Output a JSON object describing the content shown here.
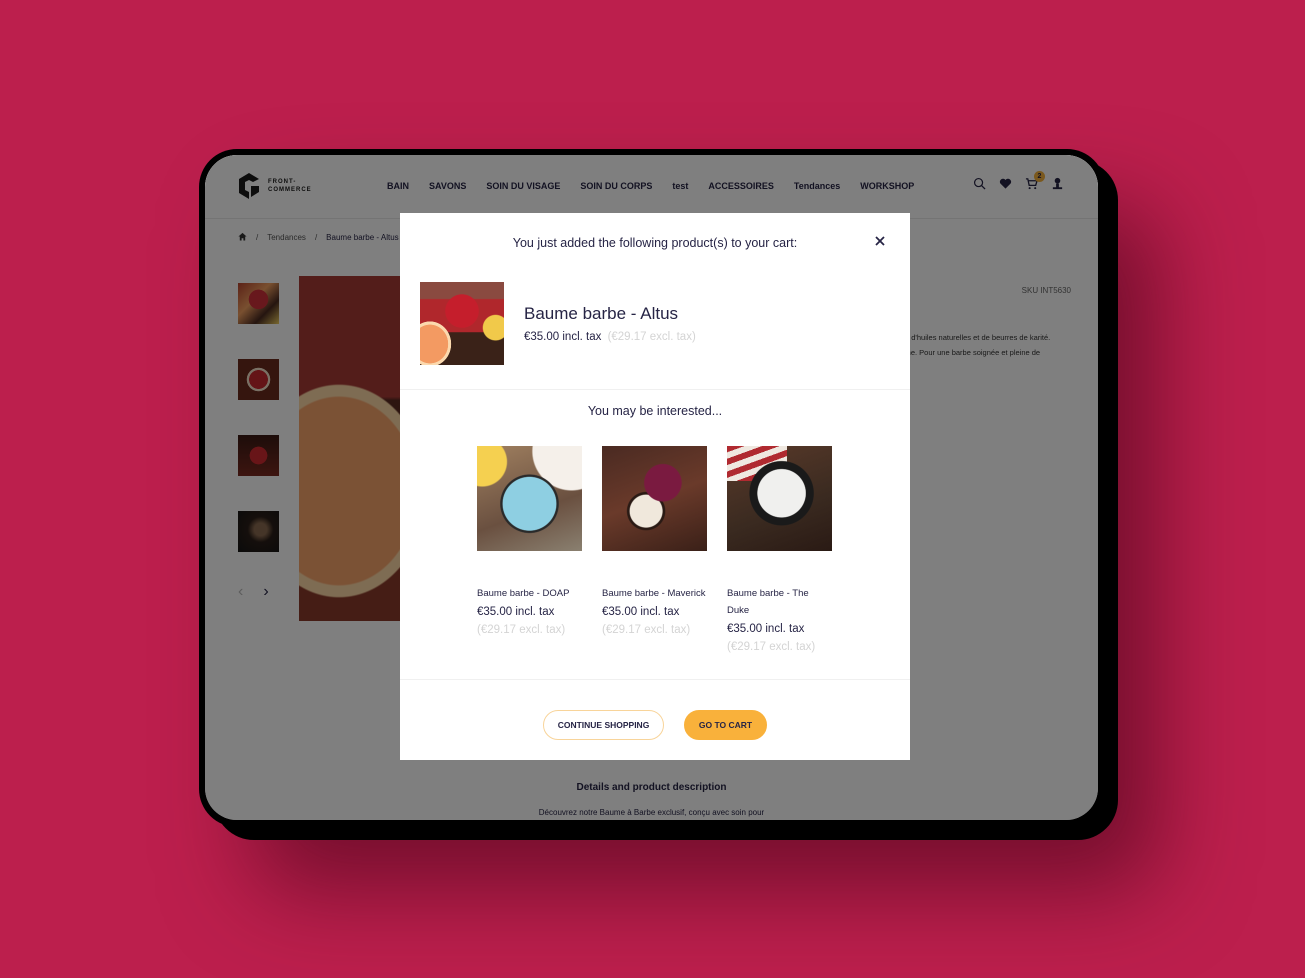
{
  "colors": {
    "background": "#bc1f4d",
    "accent": "#f9b13b",
    "text": "#262445",
    "muted": "#d4d4d4"
  },
  "header": {
    "logo": {
      "line1": "FRONT-",
      "line2": "COMMERCE",
      "icon": "front-commerce-logo"
    },
    "nav": [
      "BAIN",
      "SAVONS",
      "SOIN DU VISAGE",
      "SOIN DU CORPS",
      "test",
      "ACCESSOIRES",
      "Tendances",
      "WORKSHOP"
    ],
    "icons": {
      "search": "search-icon",
      "wishlist": "heart-icon",
      "cart": "cart-icon",
      "account": "user-icon"
    },
    "cart_count": "2"
  },
  "breadcrumb": {
    "home_icon": "home-icon",
    "separator": "/",
    "items": [
      "Tendances",
      "Baume barbe - Altus"
    ]
  },
  "product_page": {
    "sku": "SKU INT5630",
    "description_lines": [
      "e d'huiles naturelles et de beurres de karité.",
      "ine. Pour une barbe soignée et pleine de"
    ],
    "details_title": "Details and product description",
    "details_text": "Découvrez notre Baume à Barbe exclusif, conçu avec soin pour",
    "gallery": {
      "thumbnail_count": 4,
      "prev": "‹",
      "next": "›"
    }
  },
  "modal": {
    "title": "You just added the following product(s) to your cart:",
    "close_icon": "close-icon",
    "added_product": {
      "name": "Baume barbe - Altus",
      "price_incl": "€35.00 incl. tax",
      "price_excl": "(€29.17 excl. tax)"
    },
    "interested_title": "You may be interested...",
    "recommendations": [
      {
        "name": "Baume barbe - DOAP",
        "price_incl": "€35.00 incl. tax",
        "price_excl": "(€29.17 excl. tax)"
      },
      {
        "name": "Baume barbe - Maverick",
        "price_incl": "€35.00 incl. tax",
        "price_excl": "(€29.17 excl. tax)"
      },
      {
        "name": "Baume barbe - The Duke",
        "price_incl": "€35.00 incl. tax",
        "price_excl": "(€29.17 excl. tax)"
      }
    ],
    "continue_label": "CONTINUE SHOPPING",
    "cart_label": "GO TO CART"
  }
}
